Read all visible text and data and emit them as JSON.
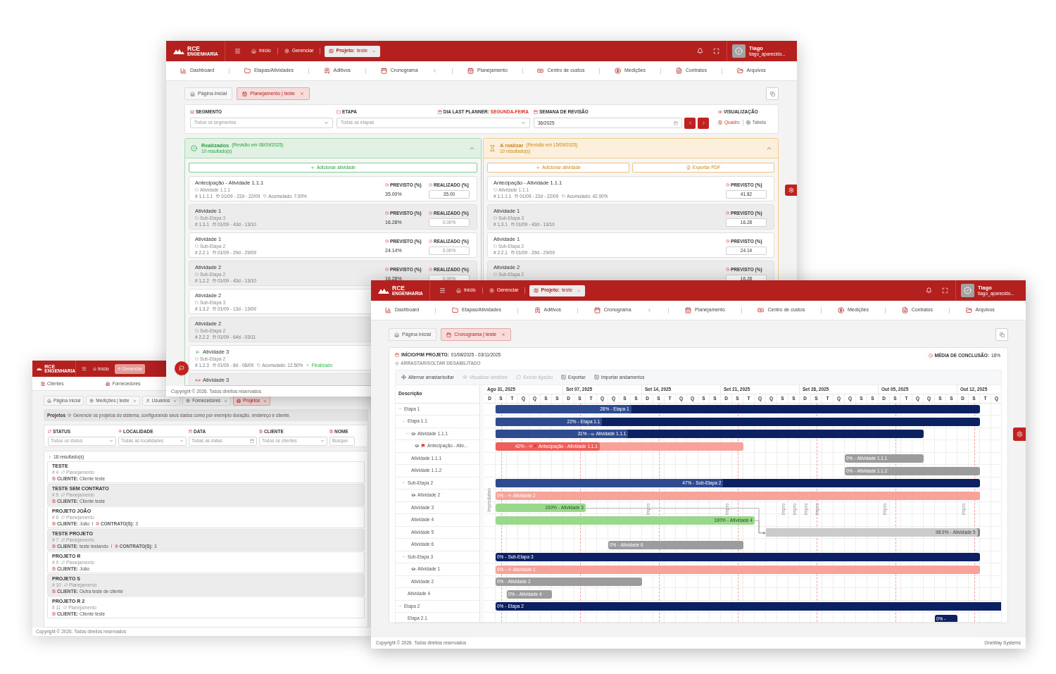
{
  "planning_window": {
    "header": {
      "logo": "RCE",
      "logo_sub": "ENGENHARIA",
      "menu": [
        {
          "label": "Início",
          "selected": false
        },
        {
          "label": "Gerenciar",
          "selected": false
        }
      ],
      "project_label": "Projeto:",
      "project_value": "teste",
      "user_name": "Tiago",
      "user_login": "tiago_aparecido..."
    },
    "nav": [
      "Dashboard",
      "Etapas/Atividades",
      "Aditivos",
      "Cronograma",
      "Planejamento",
      "Centro de custos",
      "Medições",
      "Contratos",
      "Arquivos"
    ],
    "tabs": [
      {
        "label": "Página inicial",
        "selected": false,
        "closable": false
      },
      {
        "label": "Planejamento | teste",
        "selected": true,
        "closable": true
      }
    ],
    "filters": {
      "segment": {
        "label": "SEGMENTO",
        "placeholder": "Todos os segmentos"
      },
      "stage": {
        "label": "ETAPA",
        "placeholder": "Todas as etapas"
      },
      "planner_day": {
        "label": "DIA LAST PLANNER:",
        "value": "SEGUNDA-FEIRA"
      },
      "week": {
        "label": "SEMANA DE REVISÃO",
        "value": "36/2025"
      },
      "view": {
        "label": "VISUALIZAÇÃO",
        "options": [
          {
            "label": "Quadro",
            "selected": true
          },
          {
            "label": "Tabela",
            "selected": false
          }
        ]
      }
    },
    "columns": [
      {
        "kind": "done",
        "title": "Realizados",
        "subtitle": "(Revisão em 08/09/2025)",
        "count": "10 resultado(s)",
        "expanded": true,
        "buttons": [
          {
            "label": "Adicionar atividade",
            "kind": "add"
          }
        ],
        "cards": [
          {
            "kind": "plain",
            "title": "Antecipação - Atividade 1.1.1",
            "folder": "Atividade 1.1.1",
            "code": "# 1.1.1.1",
            "dates": "01/09 - 22d - 22/09",
            "accumulated": "Acumulado: 7.00%",
            "previsto_label": "PREVISTO (%)",
            "previsto": "35.00%",
            "realizado_label": "REALIZADO (%)",
            "realizado": "35.00"
          },
          {
            "kind": "plain",
            "title": "Atividade 1",
            "folder": "Sub-Etapa 3",
            "code": "# 1.3.1",
            "dates": "01/09 - 43d - 13/10",
            "previsto_label": "PREVISTO (%)",
            "previsto": "16.28%",
            "realizado_label": "REALIZADO (%)",
            "realizado_placeholder": "0.00%"
          },
          {
            "kind": "plain",
            "title": "Atividade 1",
            "folder": "Sub-Etapa 2",
            "code": "# 2.2.1",
            "dates": "01/09 - 29d - 29/09",
            "previsto_label": "PREVISTO (%)",
            "previsto": "24.14%",
            "realizado_label": "REALIZADO (%)",
            "realizado_placeholder": "0.00%"
          },
          {
            "kind": "plain",
            "title": "Atividade 2",
            "folder": "Sub-Etapa 2",
            "code": "# 1.2.2",
            "dates": "01/09 - 43d - 13/10",
            "previsto_label": "PREVISTO (%)",
            "previsto": "16.28%",
            "realizado_label": "REALIZADO (%)",
            "realizado_placeholder": "0.00%"
          },
          {
            "kind": "plain",
            "title": "Atividade 2",
            "folder": "Sub-Etapa 3",
            "code": "# 1.3.2",
            "dates": "01/09 - 13d - 13/09"
          },
          {
            "kind": "plain",
            "title": "Atividade 2",
            "folder": "Sub-Etapa 2",
            "code": "# 2.2.2",
            "dates": "01/09 - 64d - 03/11"
          },
          {
            "kind": "finished",
            "title": "Atividade 3",
            "folder": "Sub-Etapa 2",
            "code": "# 1.2.3",
            "dates": "01/09 - 8d - 08/09",
            "accumulated": "Acumulado: 12.50%",
            "status": "Finalizado"
          },
          {
            "kind": "moved",
            "title": "Atividade 3"
          }
        ]
      },
      {
        "kind": "todo",
        "title": "A realizar",
        "subtitle": "(Revisão em 15/09/2025)",
        "count": "10 resultado(s)",
        "expanded": true,
        "buttons": [
          {
            "label": "Adicionar atividade",
            "kind": "add"
          },
          {
            "label": "Exportar PDF",
            "kind": "export"
          }
        ],
        "cards": [
          {
            "title": "Antecipação - Atividade 1.1.1",
            "folder": "Atividade 1.1.1",
            "code": "# 1.1.1.1",
            "dates": "01/09 - 22d - 22/09",
            "accumulated": "Acumulado: 42.00%",
            "previsto_label": "PREVISTO (%)",
            "previsto_value": "41.82"
          },
          {
            "title": "Atividade 1",
            "folder": "Sub-Etapa 3",
            "code": "# 1.3.1",
            "dates": "01/09 - 43d - 13/10",
            "previsto_label": "PREVISTO (%)",
            "previsto_value": "16.28"
          },
          {
            "title": "Atividade 1",
            "folder": "Sub-Etapa 2",
            "code": "# 2.2.1",
            "dates": "01/09 - 29d - 29/09",
            "previsto_label": "PREVISTO (%)",
            "previsto_value": "24.14"
          },
          {
            "title": "Atividade 2",
            "folder": "Sub-Etapa 2",
            "previsto_label": "PREVISTO (%)",
            "previsto_value": "16.28"
          }
        ]
      }
    ],
    "footer": "Copyright © 2026. Todos direitos reservados"
  },
  "projects_window": {
    "header": {
      "logo": "RCE",
      "logo_sub": "ENGENHARIA",
      "menu": [
        {
          "label": "Início",
          "selected": false
        },
        {
          "label": "Gerenciar",
          "selected": true
        }
      ]
    },
    "nav": [
      "Clientes",
      "Fornecedores"
    ],
    "tabs": [
      {
        "label": "Página inicial",
        "selected": false,
        "closable": false
      },
      {
        "label": "Medições | teste",
        "selected": false,
        "closable": true
      },
      {
        "label": "Usuários",
        "selected": false,
        "closable": true
      },
      {
        "label": "Fornecedores",
        "selected": false,
        "closable": true
      },
      {
        "label": "Projetos",
        "selected": true,
        "closable": true
      }
    ],
    "info": {
      "title": "Projetos",
      "text": "Gerencie os projetos do sistema, configurando seus dados como por exemplo duração, endereço e cliente."
    },
    "filters": [
      {
        "kind": "select",
        "label": "STATUS",
        "placeholder": "Todos os status"
      },
      {
        "kind": "select",
        "label": "LOCALIDADE",
        "placeholder": "Todas as localidades"
      },
      {
        "kind": "date",
        "label": "DATA",
        "placeholder": "Todas as datas"
      },
      {
        "kind": "select",
        "label": "CLIENTE",
        "placeholder": "Todos os clientes"
      },
      {
        "kind": "text",
        "label": "NOME",
        "placeholder": "Busque"
      }
    ],
    "results": {
      "count": "18 resultado(s)",
      "rows": [
        {
          "name": "TESTE",
          "code": "# 4",
          "phase": "Planejamento",
          "client_label": "CLIENTE:",
          "client": "Cliente teste"
        },
        {
          "name": "TESTE SEM CONTRATO",
          "code": "# 5",
          "phase": "Planejamento",
          "client_label": "CLIENTE:",
          "client": "Cliente teste"
        },
        {
          "name": "PROJETO JOÃO",
          "code": "# 6",
          "phase": "Planejamento",
          "client_label": "CLIENTE:",
          "client": "João",
          "contracts_label": "CONTRATO(S):",
          "contracts": "3"
        },
        {
          "name": "TESTE PROJETO",
          "code": "# 7",
          "phase": "Planejamento",
          "client_label": "CLIENTE:",
          "client": "teste testando",
          "contracts_label": "CONTRATO(S):",
          "contracts": "3"
        },
        {
          "name": "PROJETO R",
          "code": "# 9",
          "phase": "Planejamento",
          "client_label": "CLIENTE:",
          "client": "João"
        },
        {
          "name": "PROJETO S",
          "code": "# 10",
          "phase": "Planejamento",
          "client_label": "CLIENTE:",
          "client": "Outra teste de cliente"
        },
        {
          "name": "PROJETO R 2",
          "code": "# 11",
          "phase": "Planejamento",
          "client_label": "CLIENTE:",
          "client": "Cliente teste"
        }
      ]
    },
    "footer": "Copyright © 2026. Todos direitos reservados"
  },
  "schedule_window": {
    "header": {
      "logo": "RCE",
      "logo_sub": "ENGENHARIA",
      "menu": [
        {
          "label": "Início",
          "selected": false
        },
        {
          "label": "Gerenciar",
          "selected": false
        }
      ],
      "project_label": "Projeto:",
      "project_value": "teste",
      "user_name": "Tiago",
      "user_login": "tiago_aparecido..."
    },
    "nav": [
      "Dashboard",
      "Etapas/Atividades",
      "Aditivos",
      "Cronograma",
      "Planejamento",
      "Centro de custos",
      "Medições",
      "Contratos",
      "Arquivos"
    ],
    "tabs": [
      {
        "label": "Página inicial",
        "selected": false,
        "closable": false
      },
      {
        "label": "Cronograma | teste",
        "selected": true,
        "closable": true
      }
    ],
    "gantt": {
      "period_label": "INÍCIO/FIM PROJETO:",
      "period": "01/08/2025 - 03/11/2025",
      "drag_status": "ARRASTAR/SOLTAR DESABILITADO",
      "average_label": "MÉDIA DE CONCLUSÃO:",
      "average": "18%",
      "toolbar": [
        {
          "label": "Alternar arrastar/soltar",
          "disabled": false
        },
        {
          "label": "Visualizar detalhes",
          "disabled": true
        },
        {
          "label": "Excluir ligação",
          "disabled": true
        },
        {
          "label": "Exportar",
          "disabled": false
        },
        {
          "label": "Importar andamentos",
          "disabled": false
        }
      ],
      "column_title": "Descrição",
      "weeks": [
        "Ago 31, 2025",
        "Set 07, 2025",
        "Set 14, 2025",
        "Set 21, 2025",
        "Set 28, 2025",
        "Out 05, 2025",
        "Out 12, 2025"
      ],
      "day_letters": [
        "D",
        "S",
        "T",
        "Q",
        "Q",
        "S",
        "S",
        "D",
        "S",
        "T",
        "Q",
        "Q",
        "S",
        "S",
        "D",
        "S",
        "T",
        "Q",
        "Q",
        "S",
        "S",
        "D",
        "S",
        "T",
        "Q",
        "Q",
        "S",
        "S",
        "D",
        "S",
        "T",
        "Q",
        "Q",
        "S",
        "S",
        "D",
        "S",
        "T",
        "Q",
        "Q",
        "S",
        "S",
        "D",
        "S",
        "T",
        "Q"
      ],
      "nonworking": [
        {
          "label": "Improdutivo",
          "kind": "full"
        },
        {
          "label": "Impro",
          "kind": "cut"
        },
        {
          "label": "Impro",
          "kind": "cut"
        },
        {
          "label": "Impro",
          "kind": "cut"
        },
        {
          "label": "Impro",
          "kind": "cut"
        },
        {
          "label": "Impro",
          "kind": "cut"
        },
        {
          "label": "Impro",
          "kind": "cut"
        },
        {
          "label": "Impro",
          "kind": "cut"
        },
        {
          "label": "Impro",
          "kind": "cut"
        }
      ],
      "tree": [
        {
          "label": "Etapa 1",
          "expanded": true,
          "bar": {
            "kind": "summary",
            "level": 0.28,
            "percent": "28% -",
            "label": "Etapa 1"
          },
          "children": [
            {
              "label": "Etapa 1.1",
              "expanded": true,
              "bar": {
                "kind": "summary",
                "level": 0.22,
                "percent": "22% -",
                "label": "Etapa 1.1"
              },
              "children": [
                {
                  "label": "Atividade 1.1.1",
                  "expanded": true,
                  "marked": true,
                  "bar": {
                    "kind": "summary",
                    "level": 0.31,
                    "percent": "31% -",
                    "label": "Atividade 1.1.1"
                  },
                  "children": [
                    {
                      "label": "Antecipação - Ativ...",
                      "marked": true,
                      "flagged": true,
                      "bar": {
                        "kind": "critical",
                        "level": 0.42,
                        "percent": "42% -",
                        "label": "Antecipação - Atividade 1.1.1"
                      }
                    }
                  ]
                },
                {
                  "label": "Atividade 1.1.1",
                  "bar": {
                    "kind": "normal",
                    "percent": "0% -",
                    "label": "Atividade 1.1.1"
                  }
                },
                {
                  "label": "Atividade 1.1.2",
                  "bar": {
                    "kind": "normal",
                    "percent": "0% -",
                    "label": "Atividade 1.1.2"
                  }
                }
              ]
            },
            {
              "label": "Sub-Etapa 2",
              "expanded": true,
              "bar": {
                "kind": "summary",
                "level": 0.47,
                "percent": "47% -",
                "label": "Sub-Etapa 2"
              },
              "children": [
                {
                  "label": "Atividade 2",
                  "marked": true,
                  "bar": {
                    "kind": "critical",
                    "percent": "0% -",
                    "label": "Atividade 2"
                  }
                },
                {
                  "label": "Atividade 3",
                  "bar": {
                    "kind": "done",
                    "percent": "100% -",
                    "label": "Atividade 3"
                  }
                },
                {
                  "label": "Atividade 4",
                  "bar": {
                    "kind": "done",
                    "percent": "100% -",
                    "label": "Atividade 4"
                  }
                },
                {
                  "label": "Atividade 5",
                  "bar": {
                    "kind": "light",
                    "level": 0.989,
                    "percent": "98.9% -",
                    "label": "Atividade 5"
                  }
                },
                {
                  "label": "Atividade 6",
                  "bar": {
                    "kind": "normal",
                    "percent": "0% -",
                    "label": "Atividade 6"
                  }
                }
              ]
            },
            {
              "label": "Sub-Etapa 3",
              "expanded": true,
              "bar": {
                "kind": "summary",
                "percent": "0% -",
                "label": "Sub-Etapa 3"
              },
              "children": [
                {
                  "label": "Atividade 1",
                  "marked": true,
                  "bar": {
                    "kind": "critical",
                    "percent": "0% -",
                    "label": "Atividade 1"
                  }
                },
                {
                  "label": "Atividade 2",
                  "bar": {
                    "kind": "normal",
                    "percent": "0% -",
                    "label": "Atividade 2"
                  }
                }
              ]
            },
            {
              "label": "Atividade 4",
              "bar": {
                "kind": "normal",
                "percent": "0% -",
                "label": "Atividade 4"
              }
            }
          ]
        },
        {
          "label": "Etapa 2",
          "expanded": true,
          "bar": {
            "kind": "summary",
            "percent": "0% -",
            "label": "Etapa 2"
          },
          "children": [
            {
              "label": "Etapa 2.1",
              "bar": {
                "kind": "summary",
                "percent": "0% -"
              }
            }
          ]
        }
      ]
    },
    "footer": "Copyright © 2026. Todos direitos reservados",
    "company": "OneWay Systems"
  }
}
